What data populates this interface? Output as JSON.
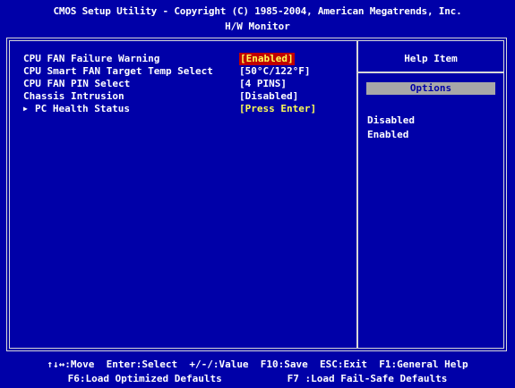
{
  "header": {
    "title": "CMOS Setup Utility - Copyright (C) 1985-2004, American Megatrends, Inc.",
    "subtitle": "H/W Monitor"
  },
  "settings": [
    {
      "label": "CPU FAN Failure Warning",
      "value": "[Enabled]",
      "selected": true
    },
    {
      "label": "CPU Smart FAN Target Temp Select",
      "value": "[50°C/122°F]"
    },
    {
      "label": "CPU FAN PIN Select",
      "value": "[4 PINS]"
    },
    {
      "label": "Chassis Intrusion",
      "value": "[Disabled]"
    },
    {
      "label": "PC Health Status",
      "value": "[Press Enter]",
      "submenu": true
    }
  ],
  "help": {
    "title": "Help Item",
    "options_label": "Options",
    "options": [
      "Disabled",
      "Enabled"
    ]
  },
  "footer": {
    "line1": "↑↓↔:Move  Enter:Select  +/-/:Value  F10:Save  ESC:Exit  F1:General Help",
    "line2": "F6:Load Optimized Defaults           F7 :Load Fail-Safe Defaults"
  },
  "colors": {
    "background": "#0000a8",
    "highlight": "#c00000",
    "value_text": "#ffff55",
    "options_bar": "#a8a8a8"
  }
}
